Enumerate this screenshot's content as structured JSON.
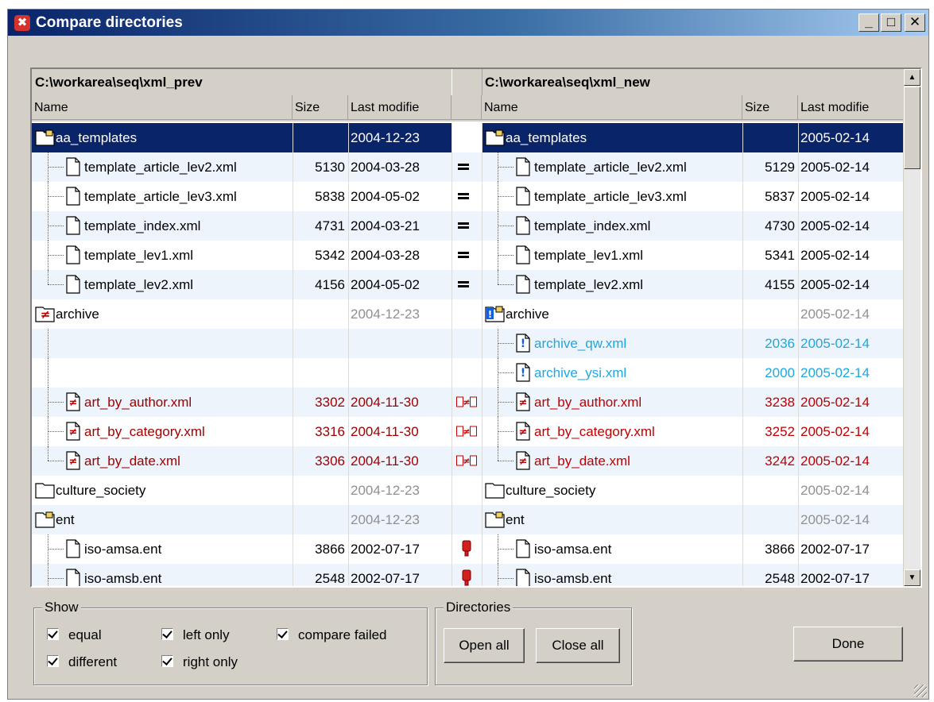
{
  "window": {
    "title": "Compare directories"
  },
  "left": {
    "path": "C:\\workarea\\seq\\xml_prev",
    "headers": {
      "name": "Name",
      "size": "Size",
      "date": "Last modifie"
    }
  },
  "right": {
    "path": "C:\\workarea\\seq\\xml_new",
    "headers": {
      "name": "Name",
      "size": "Size",
      "date": "Last modifie"
    }
  },
  "colors": {
    "selection": "#0a246a",
    "different": "#c00000",
    "right_only": "#1ea7e0",
    "dir_date": "#909090"
  },
  "rows": [
    {
      "type": "folder",
      "level": 0,
      "selected": true,
      "status": "",
      "left": {
        "name": "aa_templates",
        "size": "",
        "date": "2004-12-23",
        "icon": "folder-open-icon"
      },
      "right": {
        "name": "aa_templates",
        "size": "",
        "date": "2005-02-14",
        "icon": "folder-open-icon"
      }
    },
    {
      "type": "file",
      "level": 1,
      "status": "equal",
      "left": {
        "name": "template_article_lev2.xml",
        "size": "5130",
        "date": "2004-03-28"
      },
      "right": {
        "name": "template_article_lev2.xml",
        "size": "5129",
        "date": "2005-02-14"
      }
    },
    {
      "type": "file",
      "level": 1,
      "status": "equal",
      "left": {
        "name": "template_article_lev3.xml",
        "size": "5838",
        "date": "2004-05-02"
      },
      "right": {
        "name": "template_article_lev3.xml",
        "size": "5837",
        "date": "2005-02-14"
      }
    },
    {
      "type": "file",
      "level": 1,
      "status": "equal",
      "left": {
        "name": "template_index.xml",
        "size": "4731",
        "date": "2004-03-21"
      },
      "right": {
        "name": "template_index.xml",
        "size": "4730",
        "date": "2005-02-14"
      }
    },
    {
      "type": "file",
      "level": 1,
      "status": "equal",
      "left": {
        "name": "template_lev1.xml",
        "size": "5342",
        "date": "2004-03-28"
      },
      "right": {
        "name": "template_lev1.xml",
        "size": "5341",
        "date": "2005-02-14"
      }
    },
    {
      "type": "file",
      "level": 1,
      "last": true,
      "status": "equal",
      "left": {
        "name": "template_lev2.xml",
        "size": "4156",
        "date": "2004-05-02"
      },
      "right": {
        "name": "template_lev2.xml",
        "size": "4155",
        "date": "2005-02-14"
      }
    },
    {
      "type": "folder",
      "level": 0,
      "status": "",
      "left": {
        "name": "archive",
        "size": "",
        "date": "2004-12-23",
        "icon": "folder-different-icon"
      },
      "right": {
        "name": "archive",
        "size": "",
        "date": "2005-02-14",
        "icon": "folder-right-only-icon"
      }
    },
    {
      "type": "file",
      "level": 1,
      "status": "right_only",
      "left": {
        "name": "",
        "size": "",
        "date": ""
      },
      "right": {
        "name": "archive_qw.xml",
        "size": "2036",
        "date": "2005-02-14"
      }
    },
    {
      "type": "file",
      "level": 1,
      "status": "right_only",
      "left": {
        "name": "",
        "size": "",
        "date": ""
      },
      "right": {
        "name": "archive_ysi.xml",
        "size": "2000",
        "date": "2005-02-14"
      }
    },
    {
      "type": "file",
      "level": 1,
      "status": "different",
      "left": {
        "name": "art_by_author.xml",
        "size": "3302",
        "date": "2004-11-30"
      },
      "right": {
        "name": "art_by_author.xml",
        "size": "3238",
        "date": "2005-02-14"
      }
    },
    {
      "type": "file",
      "level": 1,
      "status": "different",
      "left": {
        "name": "art_by_category.xml",
        "size": "3316",
        "date": "2004-11-30"
      },
      "right": {
        "name": "art_by_category.xml",
        "size": "3252",
        "date": "2005-02-14"
      }
    },
    {
      "type": "file",
      "level": 1,
      "last": true,
      "status": "different",
      "left": {
        "name": "art_by_date.xml",
        "size": "3306",
        "date": "2004-11-30"
      },
      "right": {
        "name": "art_by_date.xml",
        "size": "3242",
        "date": "2005-02-14"
      }
    },
    {
      "type": "folder",
      "level": 0,
      "status": "",
      "left": {
        "name": "culture_society",
        "size": "",
        "date": "2004-12-23",
        "icon": "folder-closed-icon"
      },
      "right": {
        "name": "culture_society",
        "size": "",
        "date": "2005-02-14",
        "icon": "folder-closed-icon"
      }
    },
    {
      "type": "folder",
      "level": 0,
      "status": "",
      "left": {
        "name": "ent",
        "size": "",
        "date": "2004-12-23",
        "icon": "folder-open-icon"
      },
      "right": {
        "name": "ent",
        "size": "",
        "date": "2005-02-14",
        "icon": "folder-open-icon"
      }
    },
    {
      "type": "file",
      "level": 1,
      "status": "failed",
      "left": {
        "name": "iso-amsa.ent",
        "size": "3866",
        "date": "2002-07-17"
      },
      "right": {
        "name": "iso-amsa.ent",
        "size": "3866",
        "date": "2002-07-17"
      }
    },
    {
      "type": "file",
      "level": 1,
      "status": "failed",
      "left": {
        "name": "iso-amsb.ent",
        "size": "2548",
        "date": "2002-07-17"
      },
      "right": {
        "name": "iso-amsb.ent",
        "size": "2548",
        "date": "2002-07-17"
      }
    }
  ],
  "show": {
    "label": "Show",
    "equal": "equal",
    "left_only": "left only",
    "compare_failed": "compare failed",
    "different": "different",
    "right_only": "right only"
  },
  "directories": {
    "label": "Directories",
    "open_all": "Open all",
    "close_all": "Close all"
  },
  "done": "Done"
}
